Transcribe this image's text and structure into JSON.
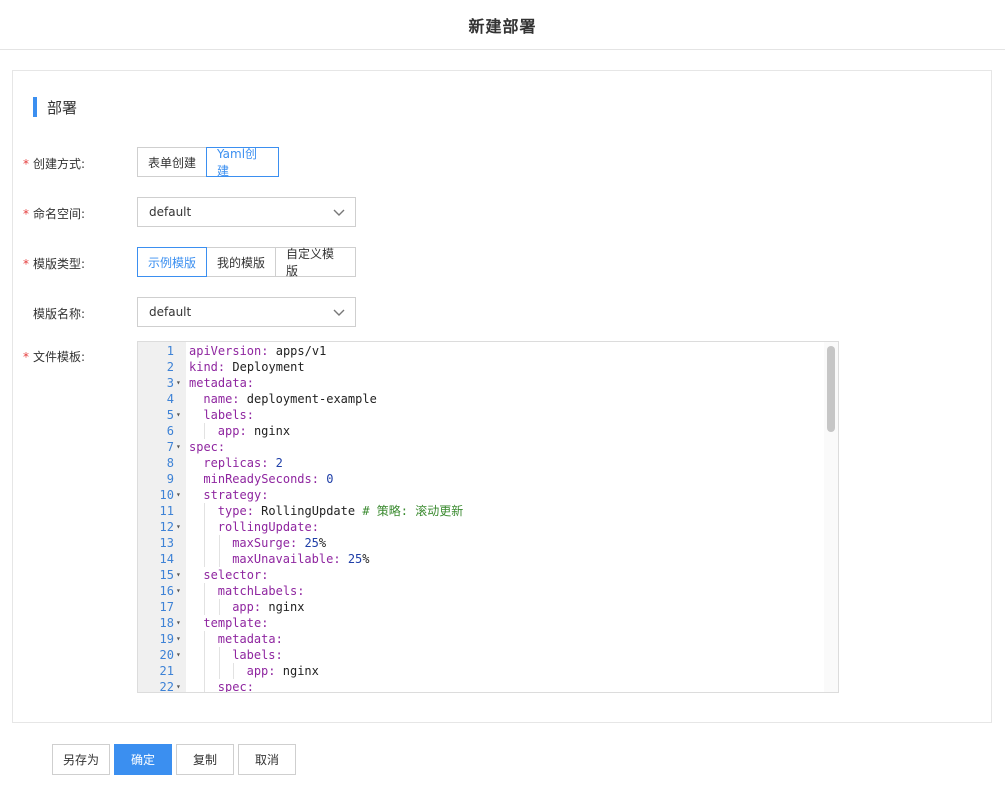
{
  "header": {
    "title": "新建部署"
  },
  "section": {
    "title": "部署"
  },
  "form": {
    "create_mode": {
      "label": "创建方式:",
      "required": "*",
      "options": [
        "表单创建",
        "Yaml创建"
      ],
      "selected": "Yaml创建"
    },
    "namespace": {
      "label": "命名空间:",
      "required": "*",
      "value": "default",
      "icon": "chevron-down-icon"
    },
    "template_type": {
      "label": "模版类型:",
      "required": "*",
      "options": [
        "示例模版",
        "我的模版",
        "自定义模版"
      ],
      "selected": "示例模版"
    },
    "template_name": {
      "label": "模版名称:",
      "value": "default",
      "icon": "chevron-down-icon"
    },
    "file_template": {
      "label": "文件模板:",
      "required": "*"
    }
  },
  "editor": {
    "lines": [
      {
        "n": "1",
        "fold": "",
        "indent": 0,
        "key": "apiVersion",
        "val": "apps/v1",
        "type": "str"
      },
      {
        "n": "2",
        "fold": "",
        "indent": 0,
        "key": "kind",
        "val": "Deployment",
        "type": "str"
      },
      {
        "n": "3",
        "fold": "▾",
        "indent": 0,
        "key": "metadata",
        "val": "",
        "type": "obj"
      },
      {
        "n": "4",
        "fold": "",
        "indent": 1,
        "key": "name",
        "val": "deployment-example",
        "type": "str"
      },
      {
        "n": "5",
        "fold": "▾",
        "indent": 1,
        "key": "labels",
        "val": "",
        "type": "obj"
      },
      {
        "n": "6",
        "fold": "",
        "indent": 2,
        "key": "app",
        "val": "nginx",
        "type": "str"
      },
      {
        "n": "7",
        "fold": "▾",
        "indent": 0,
        "key": "spec",
        "val": "",
        "type": "obj"
      },
      {
        "n": "8",
        "fold": "",
        "indent": 1,
        "key": "replicas",
        "val": "2",
        "type": "num"
      },
      {
        "n": "9",
        "fold": "",
        "indent": 1,
        "key": "minReadySeconds",
        "val": "0",
        "type": "num"
      },
      {
        "n": "10",
        "fold": "▾",
        "indent": 1,
        "key": "strategy",
        "val": "",
        "type": "obj"
      },
      {
        "n": "11",
        "fold": "",
        "indent": 2,
        "key": "type",
        "val": "RollingUpdate",
        "type": "str",
        "comment": "# 策略: 滚动更新"
      },
      {
        "n": "12",
        "fold": "▾",
        "indent": 2,
        "key": "rollingUpdate",
        "val": "",
        "type": "obj"
      },
      {
        "n": "13",
        "fold": "",
        "indent": 3,
        "key": "maxSurge",
        "val": "25",
        "suffix": "%",
        "type": "num"
      },
      {
        "n": "14",
        "fold": "",
        "indent": 3,
        "key": "maxUnavailable",
        "val": "25",
        "suffix": "%",
        "type": "num"
      },
      {
        "n": "15",
        "fold": "▾",
        "indent": 1,
        "key": "selector",
        "val": "",
        "type": "obj"
      },
      {
        "n": "16",
        "fold": "▾",
        "indent": 2,
        "key": "matchLabels",
        "val": "",
        "type": "obj"
      },
      {
        "n": "17",
        "fold": "",
        "indent": 3,
        "key": "app",
        "val": "nginx",
        "type": "str"
      },
      {
        "n": "18",
        "fold": "▾",
        "indent": 1,
        "key": "template",
        "val": "",
        "type": "obj"
      },
      {
        "n": "19",
        "fold": "▾",
        "indent": 2,
        "key": "metadata",
        "val": "",
        "type": "obj"
      },
      {
        "n": "20",
        "fold": "▾",
        "indent": 3,
        "key": "labels",
        "val": "",
        "type": "obj"
      },
      {
        "n": "21",
        "fold": "",
        "indent": 4,
        "key": "app",
        "val": "nginx",
        "type": "str"
      },
      {
        "n": "22",
        "fold": "▾",
        "indent": 2,
        "key": "spec",
        "val": "",
        "type": "obj"
      }
    ]
  },
  "footer": {
    "save_as": "另存为",
    "confirm": "确定",
    "copy": "复制",
    "cancel": "取消"
  },
  "colors": {
    "accent": "#3b8ff0",
    "required": "#e53e3e",
    "yaml_key": "#8f26a0",
    "yaml_number": "#1f3fa8",
    "yaml_comment": "#3a8a2f"
  }
}
